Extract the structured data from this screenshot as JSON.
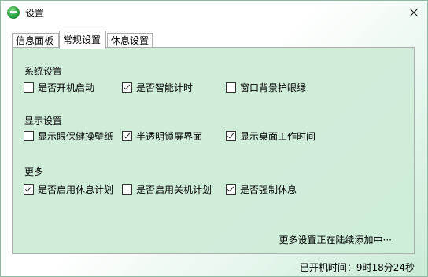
{
  "window": {
    "title": "设置",
    "close_glyph": "✕"
  },
  "tabs": [
    {
      "label": "信息面板",
      "active": false
    },
    {
      "label": "常规设置",
      "active": true
    },
    {
      "label": "休息设置",
      "active": false
    }
  ],
  "sections": {
    "system": {
      "label": "系统设置",
      "options": [
        {
          "label": "是否开机启动",
          "checked": false
        },
        {
          "label": "是否智能计时",
          "checked": true
        },
        {
          "label": "窗口背景护眼绿",
          "checked": false
        }
      ]
    },
    "display": {
      "label": "显示设置",
      "options": [
        {
          "label": "显示眼保健操壁纸",
          "checked": false
        },
        {
          "label": "半透明锁屏界面",
          "checked": true
        },
        {
          "label": "显示桌面工作时间",
          "checked": true
        }
      ]
    },
    "more": {
      "label": "更多",
      "options": [
        {
          "label": "是否启用休息计划",
          "checked": true
        },
        {
          "label": "是否启用关机计划",
          "checked": false
        },
        {
          "label": "是否强制休息",
          "checked": true
        }
      ]
    }
  },
  "more_note": "更多设置正在陆续添加中···",
  "status": {
    "uptime": "已开机时间：9时18分24秒"
  },
  "colors": {
    "panel_bg": "#cdecd8",
    "accent_green": "#2ea043"
  }
}
